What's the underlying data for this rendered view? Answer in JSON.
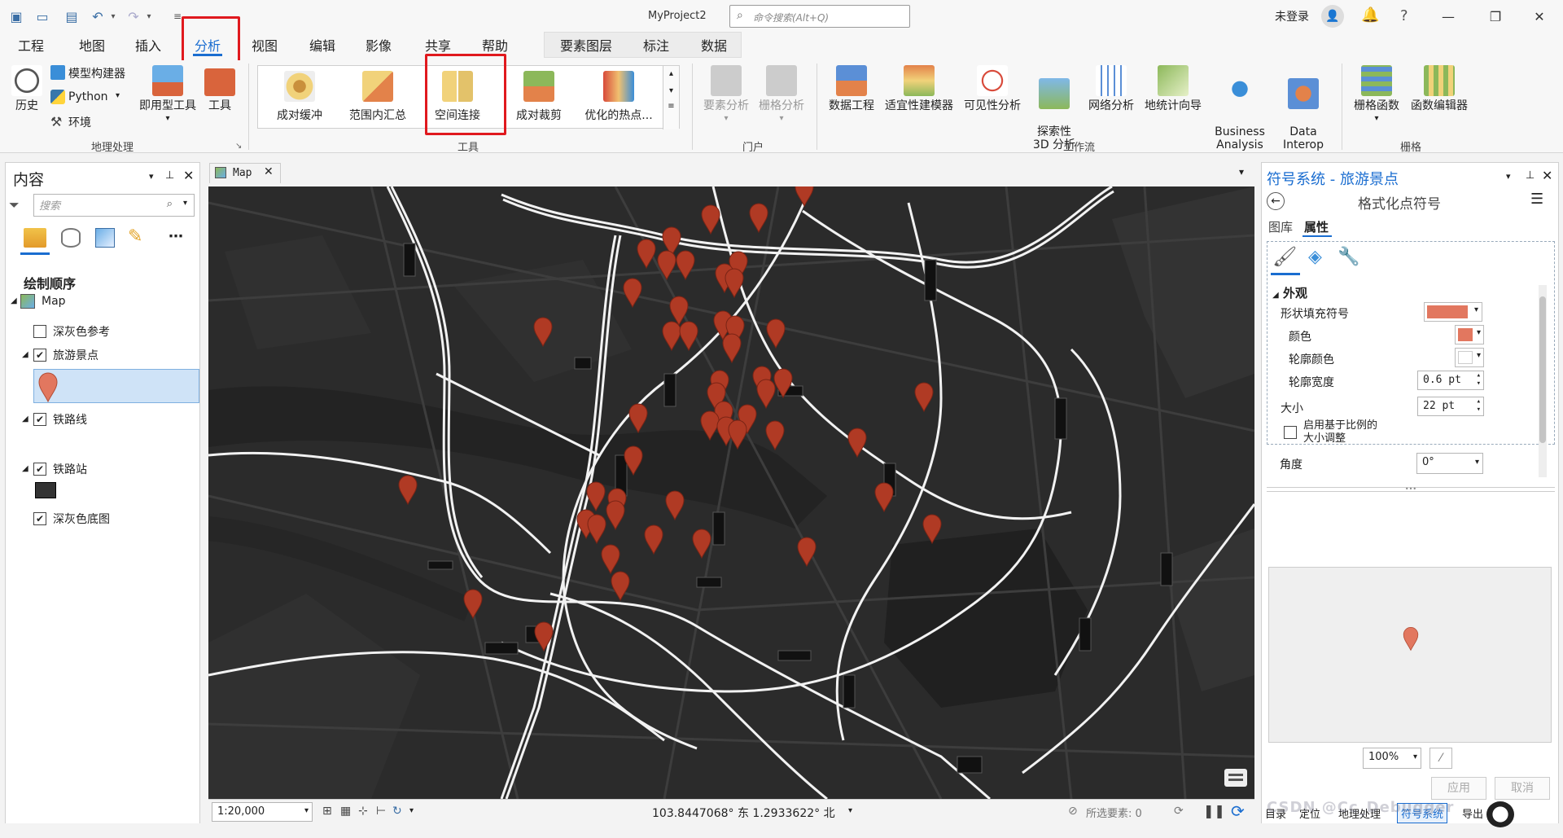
{
  "title_bar": {
    "project_name": "MyProject2",
    "command_search_placeholder": "命令搜索(Alt+Q)",
    "user_status": "未登录"
  },
  "tabs": [
    "工程",
    "地图",
    "插入",
    "分析",
    "视图",
    "编辑",
    "影像",
    "共享",
    "帮助"
  ],
  "active_tab": "分析",
  "context_tabs": [
    "要素图层",
    "标注",
    "数据"
  ],
  "ribbon": {
    "geoprocessing": {
      "history": "历史",
      "model_builder": "模型构建器",
      "python": "Python",
      "environments": "环境",
      "ready_to_use": "即用型工具",
      "tools": "工具",
      "group_label": "地理处理"
    },
    "tools_gallery": {
      "items": [
        "成对缓冲",
        "范围内汇总",
        "空间连接",
        "成对裁剪",
        "优化的热点..."
      ],
      "group_label": "工具"
    },
    "portal": {
      "items": [
        "要素分析",
        "栅格分析"
      ],
      "group_label": "门户"
    },
    "workflows": {
      "items": [
        "数据工程",
        "适宜性建模器",
        "可见性分析",
        "探索性\n3D 分析",
        "网络分析",
        "地统计向导",
        "Business\nAnalysis",
        "Data\nInterop"
      ],
      "group_label": "工作流"
    },
    "raster": {
      "items": [
        "栅格函数",
        "函数编辑器"
      ],
      "group_label": "栅格"
    }
  },
  "contents_pane": {
    "title": "内容",
    "search_placeholder": "搜索",
    "section": "绘制顺序",
    "map_name": "Map",
    "layers": [
      {
        "name": "深灰色参考",
        "checked": false
      },
      {
        "name": "旅游景点",
        "checked": true
      },
      {
        "name": "铁路线",
        "checked": true
      },
      {
        "name": "铁路站",
        "checked": true
      },
      {
        "name": "深灰色底图",
        "checked": true
      }
    ]
  },
  "map_view": {
    "tab_label": "Map",
    "scale": "1:20,000",
    "coordinates": "103.8447068° 东 1.2933622° 北",
    "selected_features": "所选要素: 0"
  },
  "symbology_pane": {
    "title": "符号系统 - 旅游景点",
    "subtitle": "格式化点符号",
    "tabs": [
      "图库",
      "属性"
    ],
    "active_tab": "属性",
    "section": "外观",
    "shape_fill_label": "形状填充符号",
    "color_label": "颜色",
    "outline_color_label": "轮廓颜色",
    "outline_width_label": "轮廓宽度",
    "outline_width_value": "0.6 pt",
    "size_label": "大小",
    "size_value": "22 pt",
    "scale_checkbox_label": "启用基于比例的\n大小调整",
    "angle_label": "角度",
    "angle_value": "0°",
    "zoom_value": "100%",
    "apply_label": "应用",
    "cancel_label": "取消"
  },
  "bottom_bar": {
    "items": [
      "目录",
      "定位",
      "地理处理",
      "符号系统",
      "导出"
    ],
    "watermark": "CSDN @Cc_Debugger"
  },
  "colors": {
    "accent": "#1a6dd0",
    "highlight": "#e0191e",
    "marker": "#b03a24",
    "symbol_fill": "#e2775f",
    "map_bg": "#2b2b2b"
  }
}
